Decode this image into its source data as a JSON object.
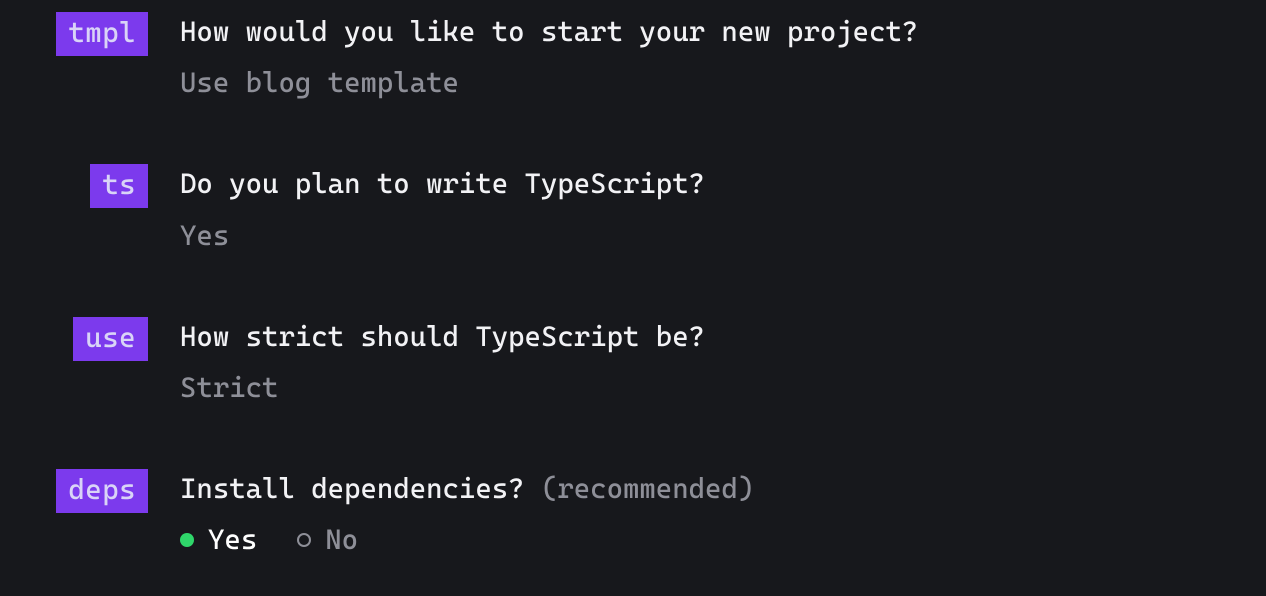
{
  "prompts": [
    {
      "tag": "tmpl",
      "question": "How would you like to start your new project?",
      "answer": "Use blog template"
    },
    {
      "tag": "ts",
      "question": "Do you plan to write TypeScript?",
      "answer": "Yes"
    },
    {
      "tag": "use",
      "question": "How strict should TypeScript be?",
      "answer": "Strict"
    },
    {
      "tag": "deps",
      "question": "Install dependencies?",
      "hint": "(recommended)",
      "choices": {
        "yes": "Yes",
        "no": "No",
        "selected": "yes"
      }
    }
  ]
}
